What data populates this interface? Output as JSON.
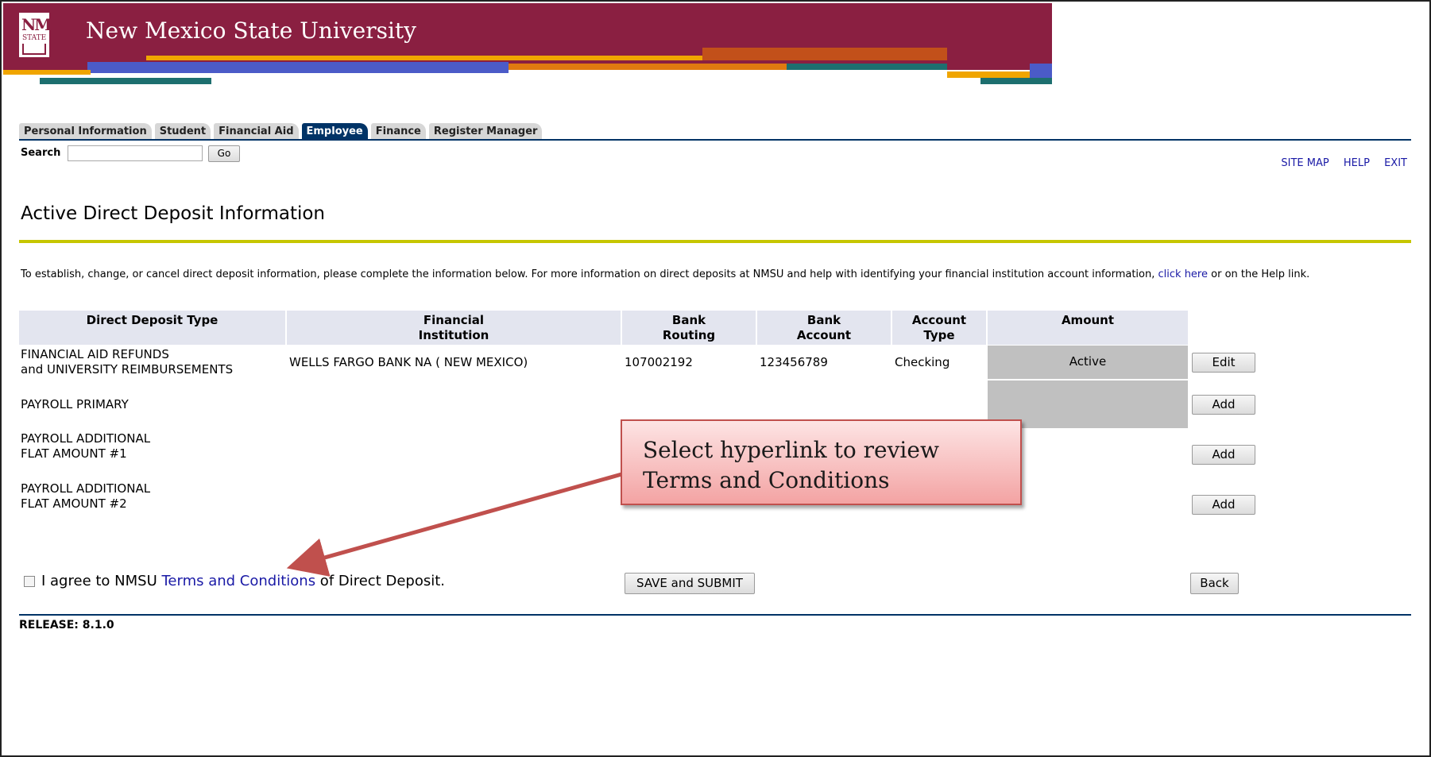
{
  "banner": {
    "title": "New Mexico State University",
    "logo_text": "NM",
    "logo_sub": "STATE",
    "colors": {
      "maroon": "#8a1f41",
      "gold": "#f0a500",
      "blue": "#4b5bc8",
      "orange": "#e07a10",
      "teal": "#1d6f6f"
    }
  },
  "tabs": [
    {
      "label": "Personal Information",
      "active": false
    },
    {
      "label": "Student",
      "active": false
    },
    {
      "label": "Financial Aid",
      "active": false
    },
    {
      "label": "Employee",
      "active": true
    },
    {
      "label": "Finance",
      "active": false
    },
    {
      "label": "Register Manager",
      "active": false
    }
  ],
  "search": {
    "label": "Search",
    "value": "",
    "button": "Go"
  },
  "top_links": {
    "site_map": "SITE MAP",
    "help": "HELP",
    "exit": "EXIT"
  },
  "page_title": "Active Direct Deposit Information",
  "intro": {
    "text_before": "To establish, change, or cancel direct deposit information, please complete the information below. For more information on direct deposits at NMSU and help with identifying your financial institution account information, ",
    "link": "click here",
    "text_after": " or on the Help link."
  },
  "table": {
    "headers": {
      "type": "Direct Deposit Type",
      "institution_1": "Financial",
      "institution_2": "Institution",
      "routing_1": "Bank",
      "routing_2": "Routing",
      "account_1": "Bank",
      "account_2": "Account",
      "acct_type_1": "Account",
      "acct_type_2": "Type",
      "amount": "Amount"
    },
    "rows": [
      {
        "type_line1": "FINANCIAL AID REFUNDS",
        "type_line2": "and UNIVERSITY REIMBURSEMENTS",
        "institution": "WELLS FARGO BANK NA ( NEW MEXICO)",
        "routing": "107002192",
        "account": "123456789",
        "account_type": "Checking",
        "amount": "Active",
        "action": "Edit"
      },
      {
        "type_line1": "PAYROLL PRIMARY",
        "type_line2": "",
        "institution": "",
        "routing": "",
        "account": "",
        "account_type": "",
        "amount": "",
        "action": "Add"
      },
      {
        "type_line1": "PAYROLL ADDITIONAL",
        "type_line2": "FLAT AMOUNT #1",
        "institution": "",
        "routing": "",
        "account": "",
        "account_type": "",
        "amount": "",
        "action": "Add"
      },
      {
        "type_line1": "PAYROLL ADDITIONAL",
        "type_line2": "FLAT AMOUNT #2",
        "institution": "",
        "routing": "",
        "account": "",
        "account_type": "",
        "amount": "",
        "action": "Add"
      }
    ]
  },
  "callout": {
    "line1": "Select hyperlink to review",
    "line2": "Terms and Conditions"
  },
  "agree": {
    "before": "I agree to NMSU ",
    "link": "Terms and Conditions",
    "after": " of Direct Deposit.",
    "checked": false
  },
  "buttons": {
    "save": "SAVE and SUBMIT",
    "back": "Back"
  },
  "release": "RELEASE: 8.1.0"
}
